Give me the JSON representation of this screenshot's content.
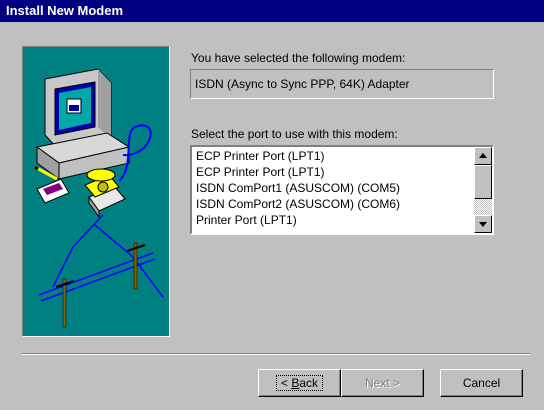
{
  "window": {
    "title": "Install New Modem"
  },
  "main": {
    "selected_label": "You have selected the following modem:",
    "selected_modem": "ISDN (Async to Sync PPP, 64K) Adapter",
    "port_label": "Select the port to use with this modem:",
    "ports": [
      "ECP Printer Port (LPT1)",
      "ECP Printer Port (LPT1)",
      "ISDN ComPort1 (ASUSCOM) (COM5)",
      "ISDN ComPort2 (ASUSCOM) (COM6)",
      "Printer Port (LPT1)"
    ]
  },
  "buttons": {
    "back_underlined": "B",
    "back_rest": "ack",
    "back_prefix": "< ",
    "next": "Next >",
    "cancel": "Cancel"
  },
  "colors": {
    "titlebar": "#000080",
    "dialog": "#c0c0c0",
    "illustration_bg": "#008080"
  }
}
